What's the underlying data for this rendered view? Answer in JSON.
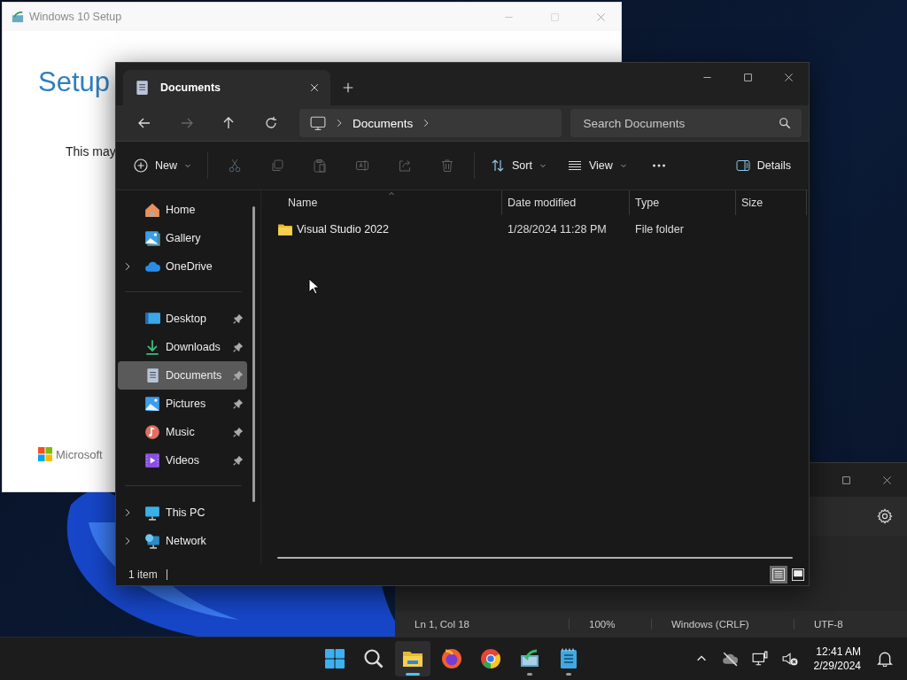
{
  "setup_window": {
    "title": "Windows 10 Setup",
    "heading": "Setup",
    "message": "This may",
    "brand": "Microsoft"
  },
  "notepad_window": {
    "status_bar": [
      "Ln 1, Col 18",
      "100%",
      "Windows (CRLF)",
      "UTF-8"
    ]
  },
  "explorer": {
    "tabs": [
      {
        "label": "Documents",
        "selected": true
      }
    ],
    "nav": [
      {
        "kind": "back",
        "disabled": false
      },
      {
        "kind": "forward",
        "disabled": true
      },
      {
        "kind": "up",
        "disabled": false
      },
      {
        "kind": "refresh",
        "disabled": false
      }
    ],
    "breadcrumb": [
      "Documents"
    ],
    "search": {
      "placeholder": "Search Documents"
    },
    "toolbar": [
      {
        "kind": "new",
        "label": "New",
        "disabled": false
      },
      {
        "kind": "cut",
        "disabled": true
      },
      {
        "kind": "copy",
        "disabled": true
      },
      {
        "kind": "paste",
        "disabled": true
      },
      {
        "kind": "rename",
        "disabled": true
      },
      {
        "kind": "share",
        "disabled": true
      },
      {
        "kind": "delete",
        "disabled": true
      },
      {
        "kind": "sort",
        "label": "Sort",
        "disabled": false
      },
      {
        "kind": "view",
        "label": "View",
        "disabled": false
      },
      {
        "kind": "more",
        "disabled": false
      },
      {
        "kind": "details",
        "label": "Details",
        "disabled": false
      }
    ],
    "sidebar": [
      [
        {
          "kind": "home",
          "label": "Home",
          "selected": false
        },
        {
          "kind": "gallery",
          "label": "Gallery",
          "selected": false
        },
        {
          "kind": "onedrive",
          "label": "OneDrive",
          "selected": false,
          "expanded": false
        }
      ],
      [
        {
          "kind": "desktop",
          "label": "Desktop",
          "selected": false,
          "pinned": true
        },
        {
          "kind": "downloads",
          "label": "Downloads",
          "selected": false,
          "pinned": true
        },
        {
          "kind": "documents",
          "label": "Documents",
          "selected": true,
          "pinned": true
        },
        {
          "kind": "pictures",
          "label": "Pictures",
          "selected": false,
          "pinned": true
        },
        {
          "kind": "music",
          "label": "Music",
          "selected": false,
          "pinned": true
        },
        {
          "kind": "videos",
          "label": "Videos",
          "selected": false,
          "pinned": true
        }
      ],
      [
        {
          "kind": "pc",
          "label": "This PC",
          "selected": false,
          "expanded": false
        },
        {
          "kind": "network",
          "label": "Network",
          "selected": false,
          "expanded": false
        }
      ]
    ],
    "columns": [
      "Name",
      "Date modified",
      "Type",
      "Size"
    ],
    "rows": [
      {
        "name": "Visual Studio 2022",
        "date_modified": "1/28/2024 11:28 PM",
        "type": "File folder",
        "selected": false
      }
    ],
    "status": "1 item",
    "view_modes": [
      {
        "kind": "details",
        "selected": true
      },
      {
        "kind": "tiles",
        "selected": false
      }
    ]
  },
  "taskbar": {
    "apps": [
      {
        "kind": "start",
        "running": false,
        "selected": false
      },
      {
        "kind": "search",
        "running": false,
        "selected": false
      },
      {
        "kind": "explorer",
        "running": true,
        "selected": true
      },
      {
        "kind": "firefox",
        "running": false,
        "selected": false
      },
      {
        "kind": "chrome",
        "running": false,
        "selected": false
      },
      {
        "kind": "setup",
        "running": true,
        "selected": false
      },
      {
        "kind": "notepad",
        "running": true,
        "selected": false
      }
    ],
    "time": "12:41 AM",
    "date": "2/29/2024"
  }
}
